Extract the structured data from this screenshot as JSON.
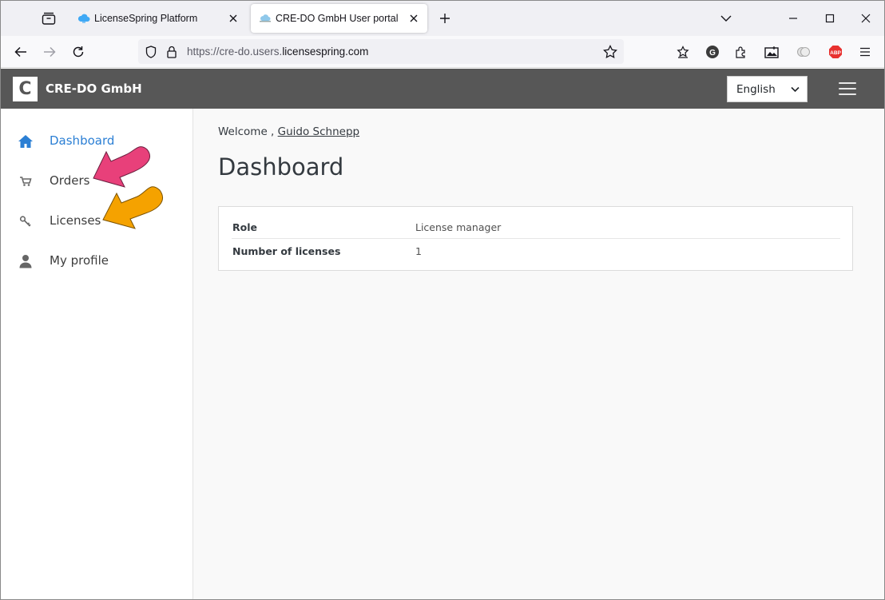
{
  "browser": {
    "tabs": [
      {
        "title": "LicenseSpring Platform",
        "active": false
      },
      {
        "title": "CRE-DO GmbH User portal",
        "active": true
      }
    ],
    "url_prefix": "https://cre-do.users.",
    "url_domain": "licensespring.com"
  },
  "site": {
    "logo_letter": "C",
    "brand": "CRE-DO GmbH",
    "language": "English"
  },
  "sidebar": {
    "items": [
      {
        "label": "Dashboard",
        "icon": "home-icon",
        "active": true
      },
      {
        "label": "Orders",
        "icon": "cart-icon",
        "active": false
      },
      {
        "label": "Licenses",
        "icon": "key-icon",
        "active": false
      },
      {
        "label": "My profile",
        "icon": "user-icon",
        "active": false
      }
    ]
  },
  "main": {
    "welcome_prefix": "Welcome ,",
    "user_name": "Guido Schnepp",
    "title": "Dashboard",
    "rows": [
      {
        "key": "Role",
        "value": "License manager"
      },
      {
        "key": "Number of licenses",
        "value": "1"
      }
    ]
  },
  "colors": {
    "header_bg": "#575757",
    "active_link": "#2b7fd4",
    "arrow_pink": "#e8407a",
    "arrow_orange": "#f5a200"
  }
}
